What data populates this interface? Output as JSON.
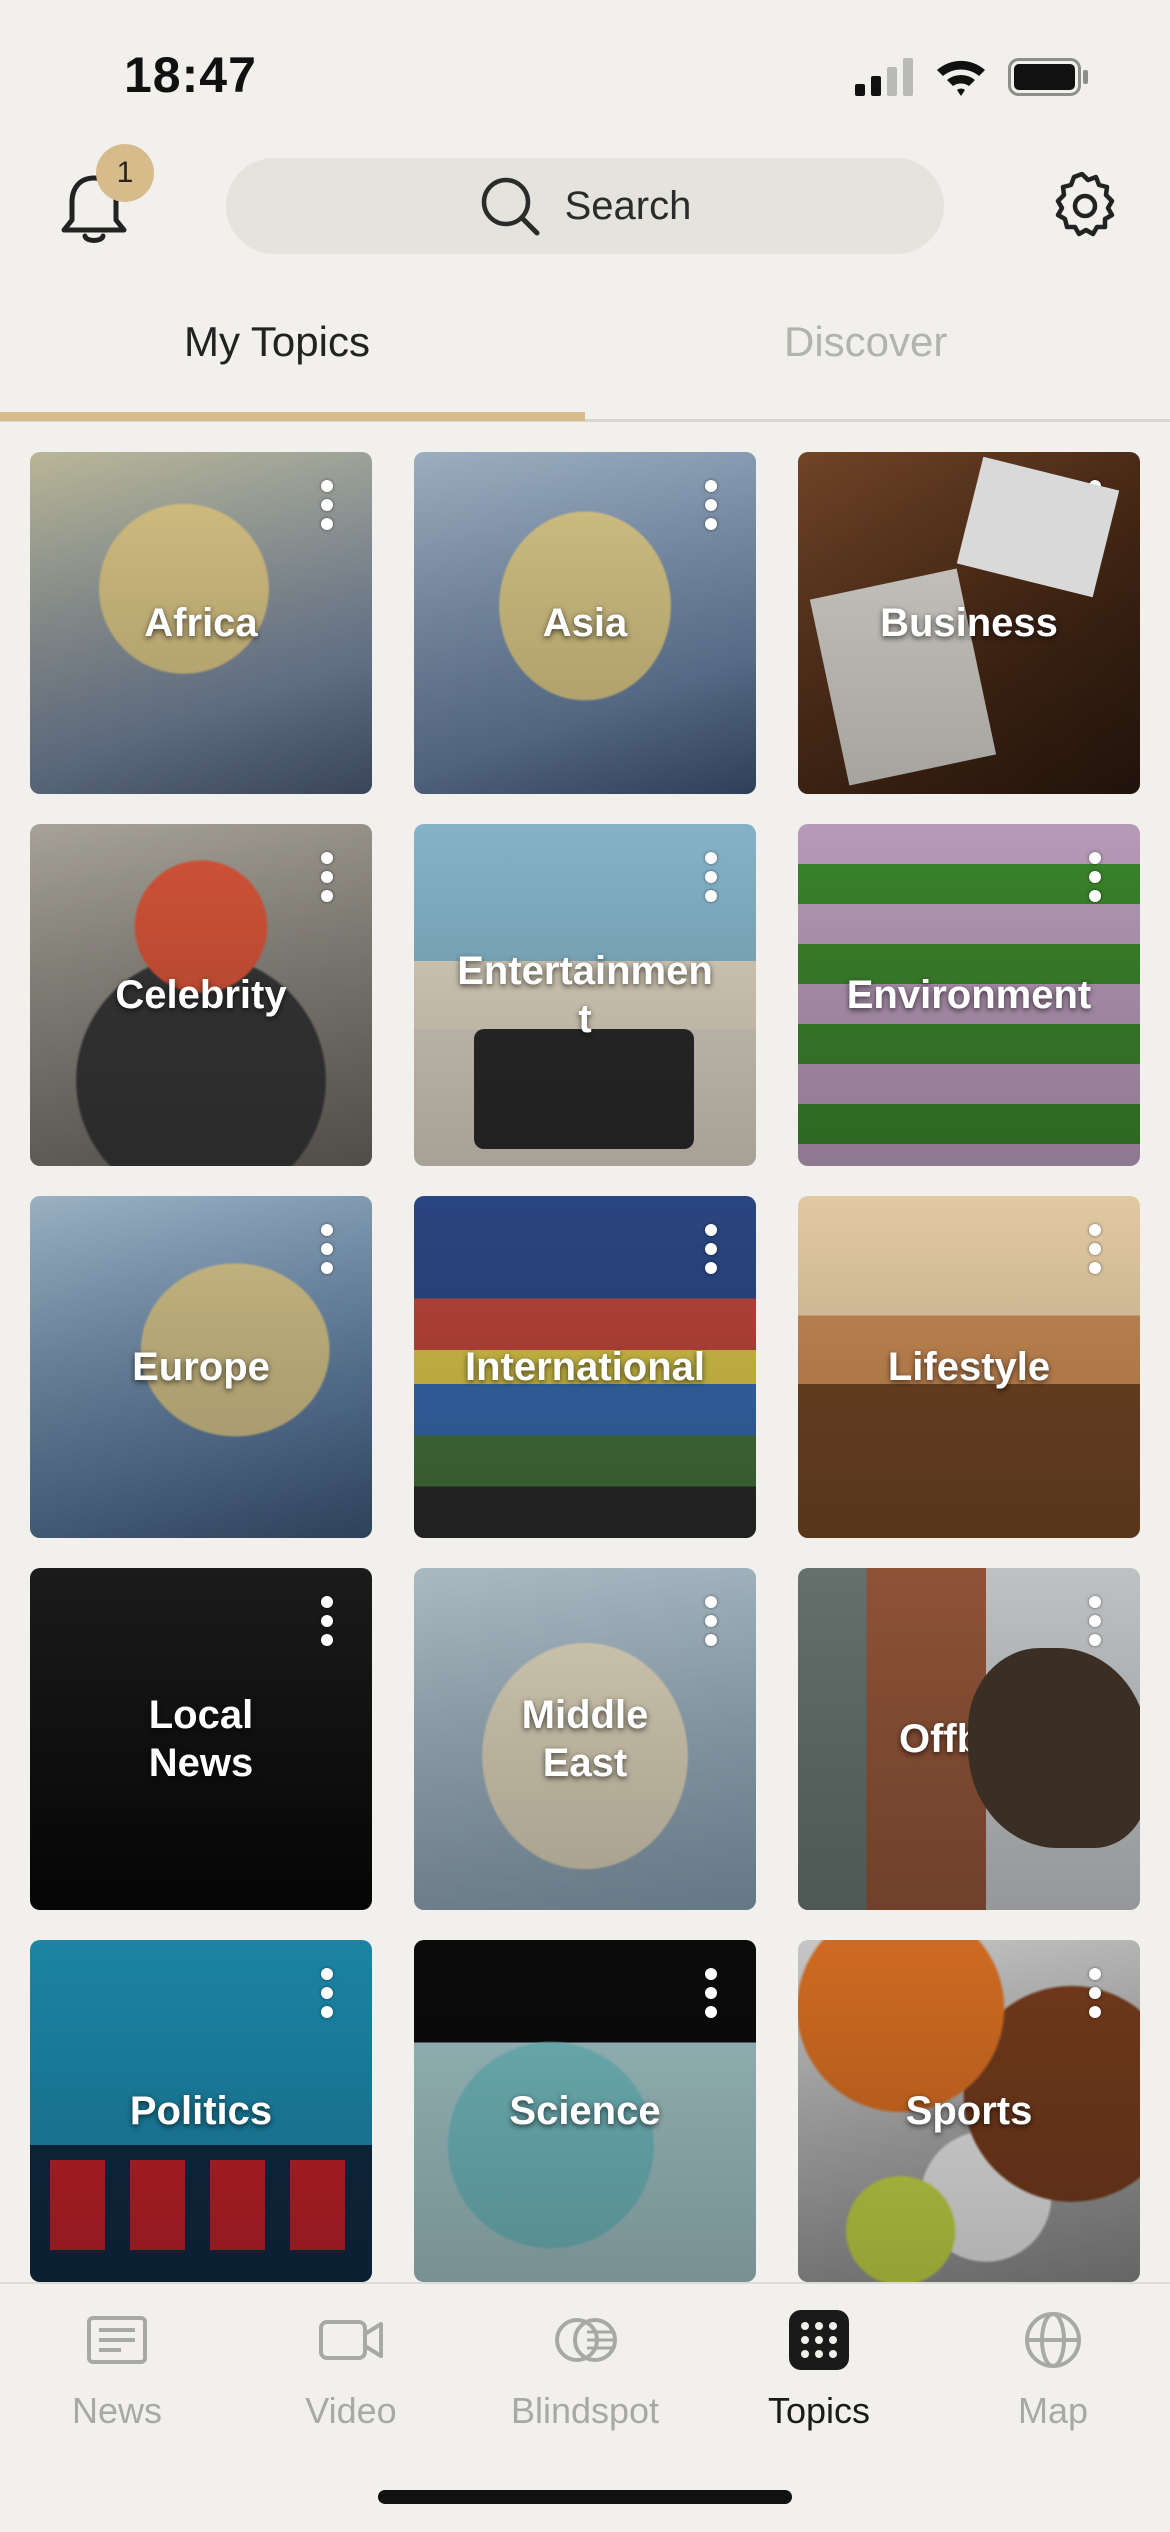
{
  "status_bar": {
    "time": "18:47",
    "icons": [
      "signal-icon",
      "wifi-icon",
      "battery-icon"
    ]
  },
  "header": {
    "notifications": {
      "icon": "bell-icon",
      "badge_count": "1"
    },
    "search": {
      "icon": "search-icon",
      "label": "Search"
    },
    "settings": {
      "icon": "gear-icon"
    }
  },
  "tabs": {
    "items": [
      {
        "label": "My Topics",
        "active": true
      },
      {
        "label": "Discover",
        "active": false
      }
    ],
    "accent_color": "#d6bb8b"
  },
  "topics": [
    {
      "label": "Africa"
    },
    {
      "label": "Asia"
    },
    {
      "label": "Business"
    },
    {
      "label": "Celebrity"
    },
    {
      "label": "Entertainmen\nt"
    },
    {
      "label": "Environment"
    },
    {
      "label": "Europe"
    },
    {
      "label": "International"
    },
    {
      "label": "Lifestyle"
    },
    {
      "label": "Local\nNews"
    },
    {
      "label": "Middle\nEast"
    },
    {
      "label": "Offbeat"
    },
    {
      "label": "Politics"
    },
    {
      "label": "Science"
    },
    {
      "label": "Sports"
    }
  ],
  "bottom_nav": {
    "items": [
      {
        "label": "News",
        "icon": "newspaper-icon",
        "active": false
      },
      {
        "label": "Video",
        "icon": "video-camera-icon",
        "active": false
      },
      {
        "label": "Blindspot",
        "icon": "blindspot-icon",
        "active": false
      },
      {
        "label": "Topics",
        "icon": "topics-grid-icon",
        "active": true
      },
      {
        "label": "Map",
        "icon": "globe-icon",
        "active": false
      }
    ]
  }
}
